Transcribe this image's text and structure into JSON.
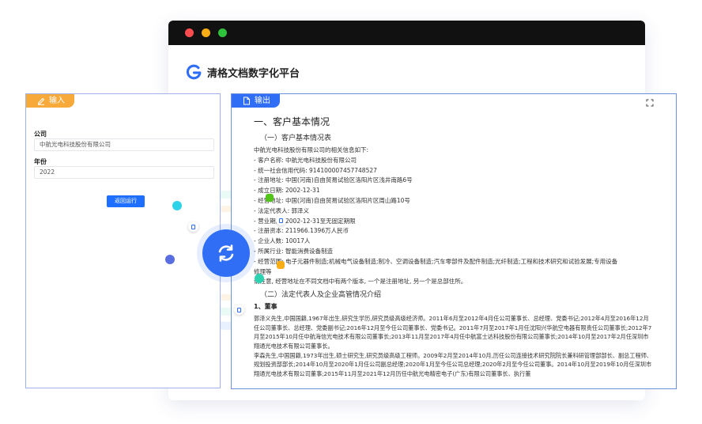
{
  "browser": {
    "brand_name": "清格文档数字化平台"
  },
  "input_panel": {
    "tab_label": "输入",
    "fields": [
      {
        "label": "公司",
        "value": "中航光电科技股份有限公司"
      },
      {
        "label": "年份",
        "value": "2022"
      }
    ],
    "button_label": "返回运行"
  },
  "output_panel": {
    "tab_label": "输出",
    "heading": "一、客户基本情况",
    "sub1": "（一）客户基本情况表",
    "intro": "中航光电科技股份有限公司的相关信息如下:",
    "lines": [
      "- 客户名称: 中航光电科技股份有限公司",
      "- 统一社会信用代码: 914100007457748527",
      "- 注册地址: 中国(河南)自由贸易试验区洛阳片区浅井南路6号",
      "- 成立日期: 2002-12-31",
      "- 经营地址: 中国(河南)自由贸易试验区洛阳片区周山路10号",
      "- 法定代表人: 郭泽义",
      "- 营业期限: 2002-12-31至无固定期限",
      "- 注册资本: 211966.1396万人民币",
      "- 企业人数: 10017人",
      "- 所属行业: 智能消费设备制造",
      "- 经营范围: 电子元器件制造;机械电气设备制造;制冷、空调设备制造;汽车零部件及配件制造;光纤制造;工程和技术研究和试验发展;专用设备",
      "修理等"
    ],
    "note": "请注意, 经营地址在不同文档中有两个版本, 一个是注册地址, 另一个是总部住所。",
    "sub2": "（二）法定代表人及企业高管情况介绍",
    "sub3": "1、董事",
    "para1": "郭泽义先生,中国国籍,1967年出生,研究生学历,研究员级高级经济师。2011年6月至2012年4月任公司董事长、总经理、党委书记;2012年4月至2016年12月任公司董事长、总经理、党委副书记;2016年12月至今任公司董事长、党委书记。2011年7月至2017年1月任沈阳兴华航空电器有限责任公司董事长;2012年7月至2015年10月任中航海信光电技术有限公司董事长;2013年11月至2017年4月任中航富士达科技股份有限公司董事长;2014年10月至2017年2月任深圳市翔通光电技术有限公司董事长。",
    "para2": "李森先生,中国国籍,1973年出生,硕士研究生,研究员级高级工程师。2009年2月至2014年10月,历任公司连接技术研究院院长兼科研管理部部长、副总工程师、规划投资部部长;2014年10月至2020年1月任公司副总经理;2020年1月至今任公司总经理;2020年2月至今任公司董事。2014年10月至2019年10月任深圳市翔通光电技术有限公司董事;2015年11月至2021年12月历任中航光电精密电子(广东)有限公司董事长、执行董"
  },
  "colors": {
    "accent_blue": "#2f6ef5",
    "input_tab": "#f7a93a"
  },
  "icons": {
    "expand": "expand-icon",
    "sync": "sync-icon",
    "edit": "pencil-icon",
    "doc": "document-icon"
  }
}
